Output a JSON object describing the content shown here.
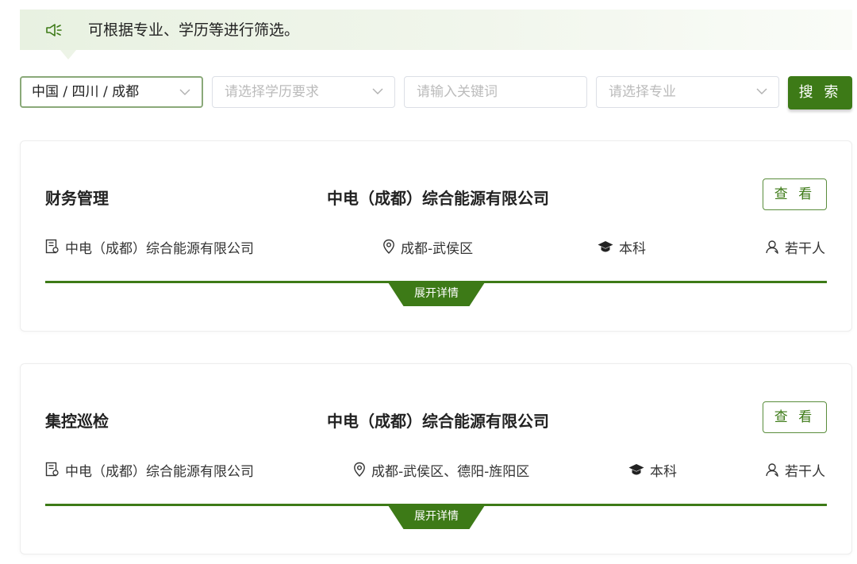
{
  "notice": {
    "icon": "megaphone-icon",
    "text": "可根据专业、学历等进行筛选。"
  },
  "filters": {
    "region_value": "中国 / 四川 / 成都",
    "education_placeholder": "请选择学历要求",
    "keyword_placeholder": "请输入关键词",
    "major_placeholder": "请选择专业",
    "search_label": "搜 索"
  },
  "jobs": [
    {
      "title": "财务管理",
      "company": "中电（成都）综合能源有限公司",
      "view_label": "查 看",
      "employer": "中电（成都）综合能源有限公司",
      "location": "成都-武侯区",
      "education": "本科",
      "headcount": "若干人",
      "expand_label": "展开详情"
    },
    {
      "title": "集控巡检",
      "company": "中电（成都）综合能源有限公司",
      "view_label": "查 看",
      "employer": "中电（成都）综合能源有限公司",
      "location": "成都-武侯区、德阳-旌阳区",
      "education": "本科",
      "headcount": "若干人",
      "expand_label": "展开详情"
    }
  ],
  "colors": {
    "brand_green": "#3d7a17",
    "notice_bg": "#e8f1e1",
    "border": "#dcdfe6"
  }
}
